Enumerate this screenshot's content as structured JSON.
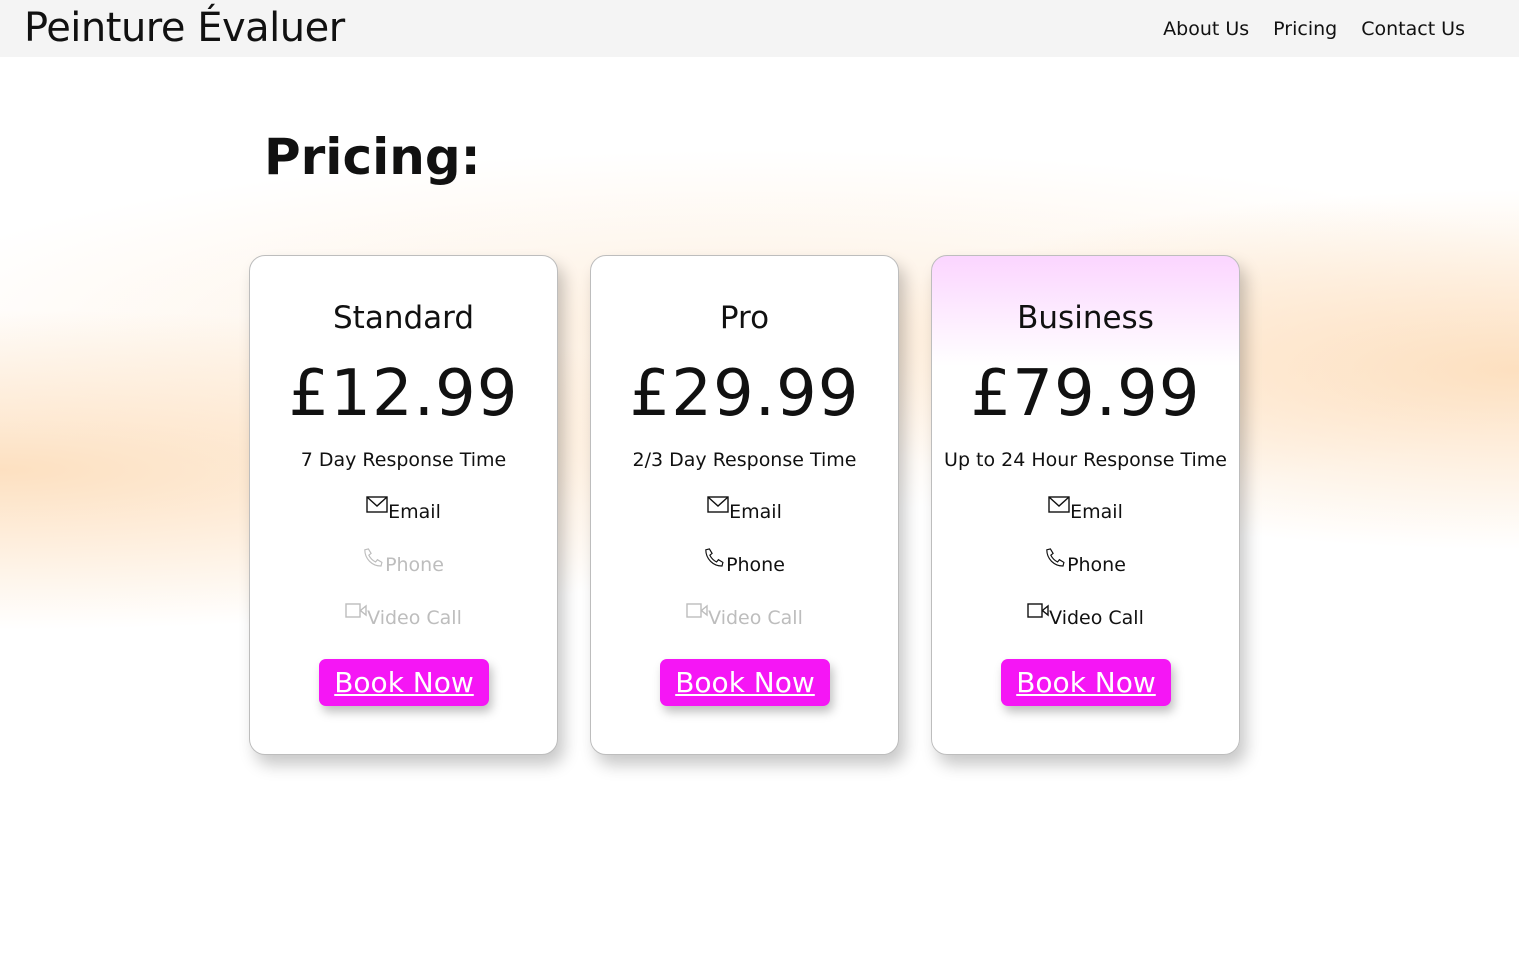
{
  "header": {
    "brand": "Peinture Évaluer",
    "nav": [
      {
        "label": "About Us"
      },
      {
        "label": "Pricing"
      },
      {
        "label": "Contact Us"
      }
    ]
  },
  "main": {
    "title": "Pricing:",
    "plans": [
      {
        "name": "Standard",
        "price": "£12.99",
        "response": "7 Day Response Time",
        "features": [
          {
            "label": "Email",
            "icon": "mail-icon",
            "enabled": true
          },
          {
            "label": "Phone",
            "icon": "phone-icon",
            "enabled": false
          },
          {
            "label": "Video Call",
            "icon": "video-icon",
            "enabled": false
          }
        ],
        "button": "Book Now",
        "highlight": false
      },
      {
        "name": "Pro",
        "price": "£29.99",
        "response": "2/3 Day Response Time",
        "features": [
          {
            "label": "Email",
            "icon": "mail-icon",
            "enabled": true
          },
          {
            "label": "Phone",
            "icon": "phone-icon",
            "enabled": true
          },
          {
            "label": "Video Call",
            "icon": "video-icon",
            "enabled": false
          }
        ],
        "button": "Book Now",
        "highlight": false
      },
      {
        "name": "Business",
        "price": "£79.99",
        "response": "Up to 24 Hour Response Time",
        "features": [
          {
            "label": "Email",
            "icon": "mail-icon",
            "enabled": true
          },
          {
            "label": "Phone",
            "icon": "phone-icon",
            "enabled": true
          },
          {
            "label": "Video Call",
            "icon": "video-icon",
            "enabled": true
          }
        ],
        "button": "Book Now",
        "highlight": true
      }
    ]
  },
  "colors": {
    "accent": "#f516f5",
    "disabled_text": "#bdbdbd",
    "highlight_tint": "#fbd5ff",
    "header_bg": "#f4f4f4"
  }
}
